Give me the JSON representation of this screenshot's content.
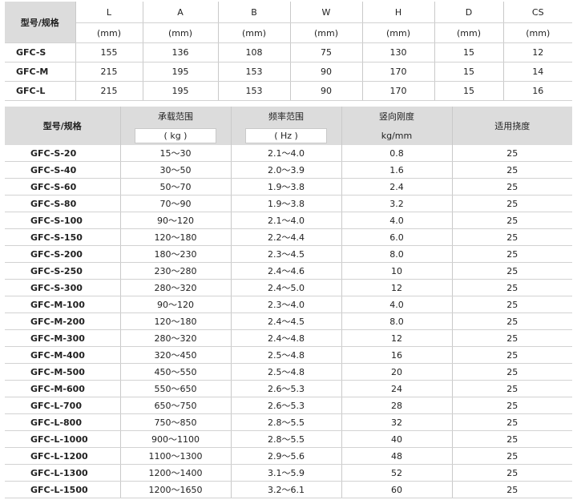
{
  "table1": {
    "header_label": "型号/规格",
    "columns": [
      {
        "name": "L",
        "unit": "(mm)"
      },
      {
        "name": "A",
        "unit": "(mm)"
      },
      {
        "name": "B",
        "unit": "(mm)"
      },
      {
        "name": "W",
        "unit": "(mm)"
      },
      {
        "name": "H",
        "unit": "(mm)"
      },
      {
        "name": "D",
        "unit": "(mm)"
      },
      {
        "name": "CS",
        "unit": "(mm)"
      }
    ],
    "rows": [
      {
        "model": "GFC-S",
        "values": [
          "155",
          "136",
          "108",
          "75",
          "130",
          "15",
          "12"
        ]
      },
      {
        "model": "GFC-M",
        "values": [
          "215",
          "195",
          "153",
          "90",
          "170",
          "15",
          "14"
        ]
      },
      {
        "model": "GFC-L",
        "values": [
          "215",
          "195",
          "153",
          "90",
          "170",
          "15",
          "16"
        ]
      }
    ]
  },
  "table2": {
    "header_label": "型号/规格",
    "col_load": "承载范围",
    "col_load_unit": "( kg )",
    "col_freq": "频率范围",
    "col_freq_unit": "( Hz )",
    "col_stiff": "竖向刚度",
    "col_stiff_unit": "kg/mm",
    "col_deflect": "适用挠度",
    "rows": [
      {
        "model": "GFC-S-20",
        "load": "15～30",
        "freq": "2.1～4.0",
        "stiff": "0.8",
        "deflect": "25"
      },
      {
        "model": "GFC-S-40",
        "load": "30～50",
        "freq": "2.0～3.9",
        "stiff": "1.6",
        "deflect": "25"
      },
      {
        "model": "GFC-S-60",
        "load": "50～70",
        "freq": "1.9～3.8",
        "stiff": "2.4",
        "deflect": "25"
      },
      {
        "model": "GFC-S-80",
        "load": "70～90",
        "freq": "1.9～3.8",
        "stiff": "3.2",
        "deflect": "25"
      },
      {
        "model": "GFC-S-100",
        "load": "90～120",
        "freq": "2.1～4.0",
        "stiff": "4.0",
        "deflect": "25"
      },
      {
        "model": "GFC-S-150",
        "load": "120～180",
        "freq": "2.2～4.4",
        "stiff": "6.0",
        "deflect": "25"
      },
      {
        "model": "GFC-S-200",
        "load": "180～230",
        "freq": "2.3～4.5",
        "stiff": "8.0",
        "deflect": "25"
      },
      {
        "model": "GFC-S-250",
        "load": "230～280",
        "freq": "2.4～4.6",
        "stiff": "10",
        "deflect": "25"
      },
      {
        "model": "GFC-S-300",
        "load": "280～320",
        "freq": "2.4～5.0",
        "stiff": "12",
        "deflect": "25"
      },
      {
        "model": "GFC-M-100",
        "load": "90～120",
        "freq": "2.3～4.0",
        "stiff": "4.0",
        "deflect": "25"
      },
      {
        "model": "GFC-M-200",
        "load": "120～180",
        "freq": "2.4～4.5",
        "stiff": "8.0",
        "deflect": "25"
      },
      {
        "model": "GFC-M-300",
        "load": "280～320",
        "freq": "2.4～4.8",
        "stiff": "12",
        "deflect": "25"
      },
      {
        "model": "GFC-M-400",
        "load": "320～450",
        "freq": "2.5～4.8",
        "stiff": "16",
        "deflect": "25"
      },
      {
        "model": "GFC-M-500",
        "load": "450～550",
        "freq": "2.5～4.8",
        "stiff": "20",
        "deflect": "25"
      },
      {
        "model": "GFC-M-600",
        "load": "550～650",
        "freq": "2.6～5.3",
        "stiff": "24",
        "deflect": "25"
      },
      {
        "model": "GFC-L-700",
        "load": "650～750",
        "freq": "2.6～5.3",
        "stiff": "28",
        "deflect": "25"
      },
      {
        "model": "GFC-L-800",
        "load": "750～850",
        "freq": "2.8～5.5",
        "stiff": "32",
        "deflect": "25"
      },
      {
        "model": "GFC-L-1000",
        "load": "900～1100",
        "freq": "2.8～5.5",
        "stiff": "40",
        "deflect": "25"
      },
      {
        "model": "GFC-L-1200",
        "load": "1100～1300",
        "freq": "2.9～5.6",
        "stiff": "48",
        "deflect": "25"
      },
      {
        "model": "GFC-L-1300",
        "load": "1200～1400",
        "freq": "3.1～5.9",
        "stiff": "52",
        "deflect": "25"
      },
      {
        "model": "GFC-L-1500",
        "load": "1200～1650",
        "freq": "3.2～6.1",
        "stiff": "60",
        "deflect": "25"
      }
    ]
  }
}
